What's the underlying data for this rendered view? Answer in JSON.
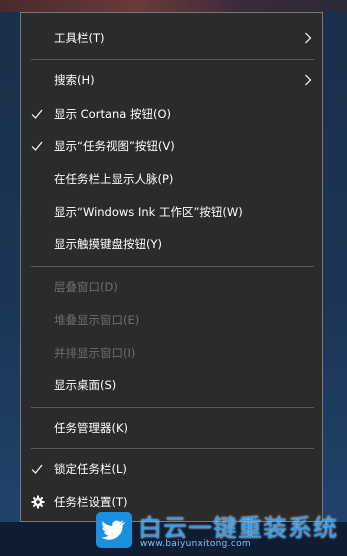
{
  "menu": {
    "items": [
      {
        "label": "工具栏(T)",
        "submenu": true
      },
      {
        "label": "搜索(H)",
        "submenu": true
      },
      {
        "label": "显示 Cortana 按钮(O)",
        "checked": true
      },
      {
        "label": "显示“任务视图”按钮(V)",
        "checked": true
      },
      {
        "label": "在任务栏上显示人脉(P)"
      },
      {
        "label": "显示“Windows Ink 工作区”按钮(W)"
      },
      {
        "label": "显示触摸键盘按钮(Y)"
      },
      {
        "label": "层叠窗口(D)",
        "disabled": true
      },
      {
        "label": "堆叠显示窗口(E)",
        "disabled": true
      },
      {
        "label": "并排显示窗口(I)",
        "disabled": true
      },
      {
        "label": "显示桌面(S)"
      },
      {
        "label": "任务管理器(K)"
      },
      {
        "label": "锁定任务栏(L)",
        "checked": true
      },
      {
        "label": "任务栏设置(T)",
        "icon": "gear-icon"
      }
    ]
  },
  "watermark": {
    "title": "白云一键重装系统",
    "url": "www.baiyunxitong.com",
    "color": "#2f9df0"
  }
}
